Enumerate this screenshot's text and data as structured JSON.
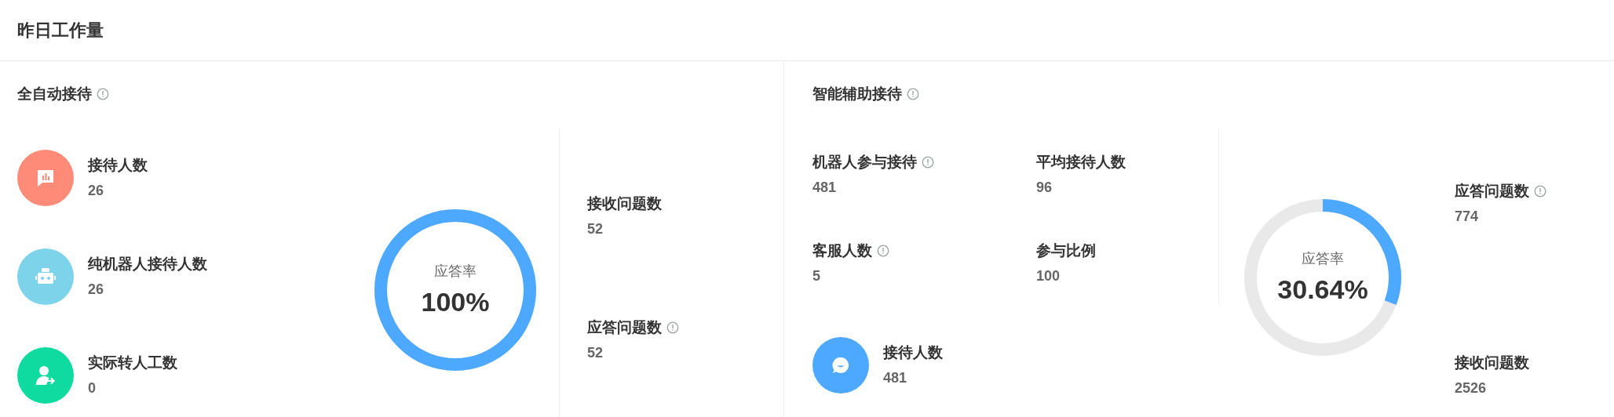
{
  "title": "昨日工作量",
  "auto": {
    "title": "全自动接待",
    "info": true,
    "items": [
      {
        "kind": "chart",
        "label": "接待人数",
        "value": "26",
        "color": "#fe8a78"
      },
      {
        "kind": "robot",
        "label": "纯机器人接待人数",
        "value": "26",
        "color": "#7dd3ea"
      },
      {
        "kind": "person",
        "label": "实际转人工数",
        "value": "0",
        "color": "#0fdba1"
      }
    ],
    "ring": {
      "label": "应答率",
      "value": "100%"
    },
    "stats": [
      {
        "label": "接收问题数",
        "value": "52",
        "info": false
      },
      {
        "label": "应答问题数",
        "value": "52",
        "info": true
      }
    ]
  },
  "assist": {
    "title": "智能辅助接待",
    "info": true,
    "grid": [
      {
        "label": "机器人参与接待",
        "value": "481",
        "info": true
      },
      {
        "label": "平均接待人数",
        "value": "96",
        "info": false
      },
      {
        "label": "客服人数",
        "value": "5",
        "info": true
      },
      {
        "label": "参与比例",
        "value": "100",
        "info": false
      }
    ],
    "item": {
      "kind": "smile",
      "label": "接待人数",
      "value": "481",
      "color": "#4da9ff"
    },
    "ring": {
      "label": "应答率",
      "value": "30.64%"
    },
    "stats": [
      {
        "label": "应答问题数",
        "value": "774",
        "info": true
      },
      {
        "label": "接收问题数",
        "value": "2526",
        "info": false
      }
    ]
  }
}
